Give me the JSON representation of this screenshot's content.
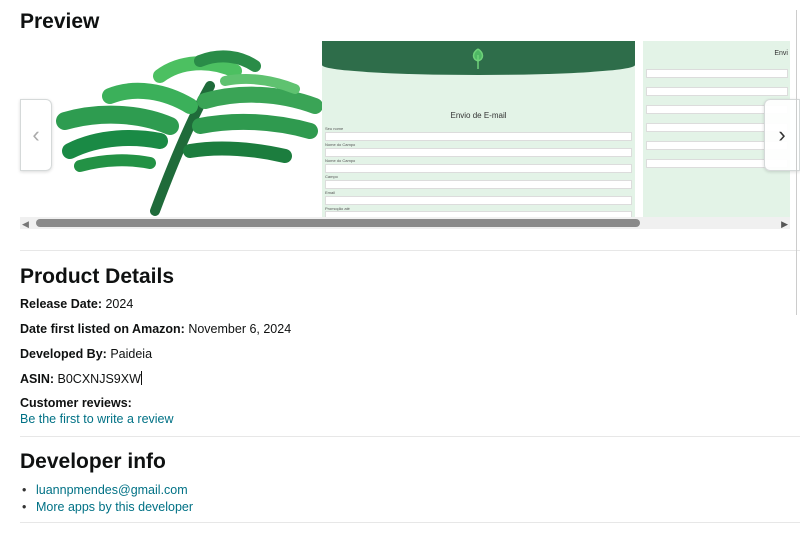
{
  "preview": {
    "title": "Preview",
    "screenshot2_title": "Envio de E-mail",
    "screenshot3_title": "Envi",
    "form_labels": [
      "Seu nome",
      "Nome do Campo",
      "Nome do Campo",
      "Campo",
      "Email",
      "Promoção até"
    ],
    "nav_prev_icon": "chevron-left-icon",
    "nav_next_icon": "chevron-right-icon"
  },
  "details": {
    "title": "Product Details",
    "release_label": "Release Date:",
    "release_value": "2024",
    "listed_label": "Date first listed on Amazon:",
    "listed_value": "November 6, 2024",
    "developer_label": "Developed By:",
    "developer_value": "Paideia",
    "asin_label": "ASIN:",
    "asin_value": "B0CXNJS9XW",
    "reviews_label": "Customer reviews:",
    "reviews_link": "Be the first to write a review"
  },
  "developer": {
    "title": "Developer info",
    "email": "luannpmendes@gmail.com",
    "more_apps": "More apps by this developer"
  },
  "colors": {
    "link": "#007185",
    "accent_green": "#2e6d4a",
    "panel_green": "#e3f3e7"
  }
}
